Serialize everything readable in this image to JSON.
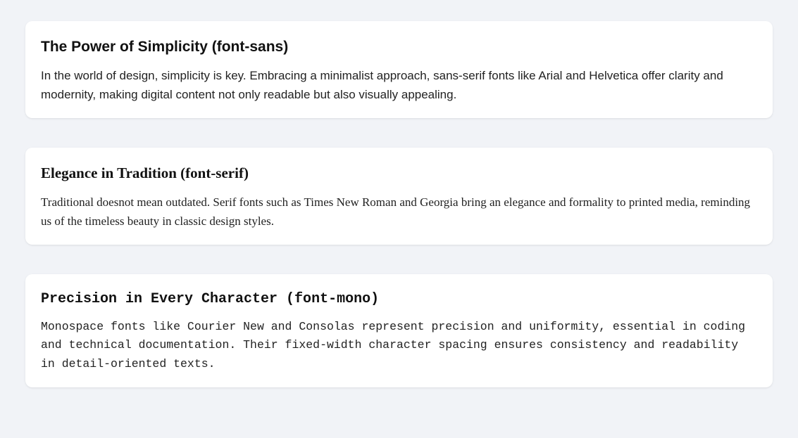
{
  "cards": [
    {
      "title": "The Power of Simplicity (font-sans)",
      "body": "In the world of design, simplicity is key. Embracing a minimalist approach, sans-serif fonts like Arial and Helvetica offer clarity and modernity, making digital content not only readable but also visually appealing."
    },
    {
      "title": "Elegance in Tradition (font-serif)",
      "body": "Traditional doesnot mean outdated. Serif fonts such as Times New Roman and Georgia bring an elegance and formality to printed media, reminding us of the timeless beauty in classic design styles."
    },
    {
      "title": "Precision in Every Character (font-mono)",
      "body": "Monospace fonts like Courier New and Consolas represent precision and uniformity, essential in coding and technical documentation. Their fixed-width character spacing ensures consistency and readability in detail-oriented texts."
    }
  ]
}
